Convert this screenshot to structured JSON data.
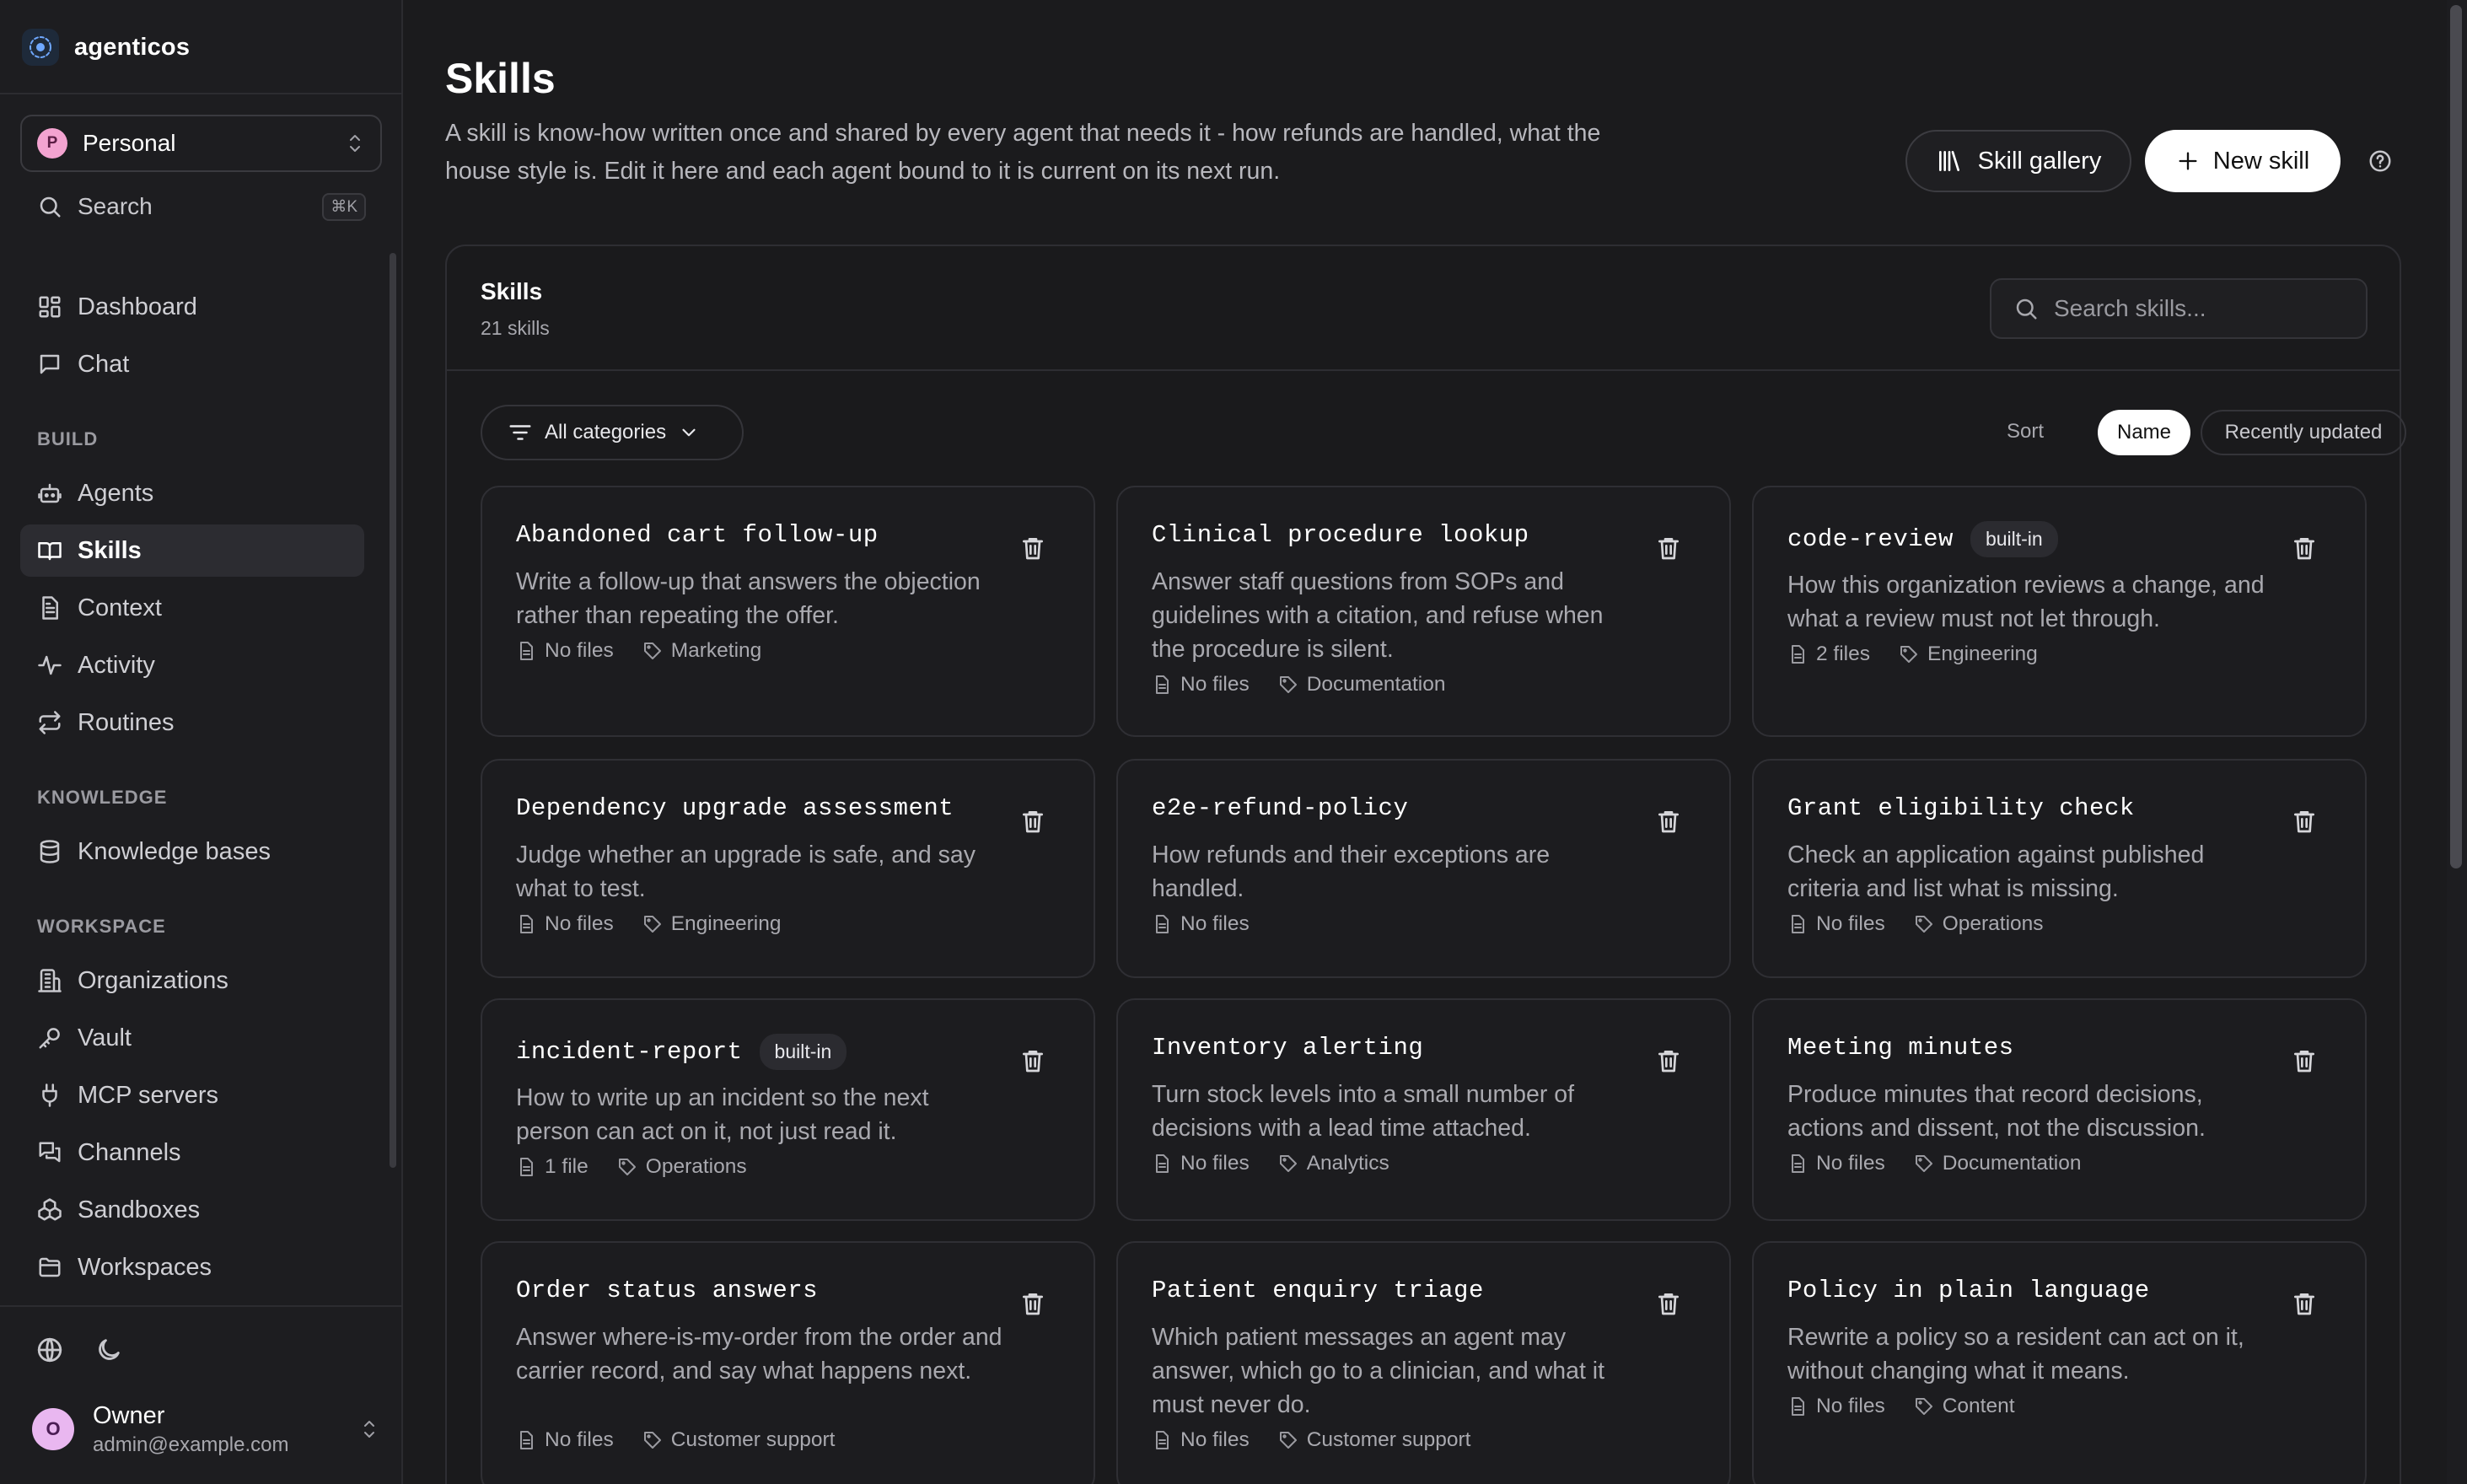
{
  "app": {
    "name": "agenticos"
  },
  "workspace": {
    "avatar": "P",
    "name": "Personal"
  },
  "search": {
    "label": "Search",
    "shortcut": "⌘K"
  },
  "nav": {
    "top": [
      {
        "id": "dashboard",
        "label": "Dashboard",
        "icon": "dashboard-icon"
      },
      {
        "id": "chat",
        "label": "Chat",
        "icon": "chat-icon"
      }
    ],
    "build_label": "BUILD",
    "build": [
      {
        "id": "agents",
        "label": "Agents",
        "icon": "bot-icon"
      },
      {
        "id": "skills",
        "label": "Skills",
        "icon": "book-icon",
        "active": true
      },
      {
        "id": "context",
        "label": "Context",
        "icon": "document-icon"
      },
      {
        "id": "activity",
        "label": "Activity",
        "icon": "activity-icon"
      },
      {
        "id": "routines",
        "label": "Routines",
        "icon": "repeat-icon"
      }
    ],
    "knowledge_label": "KNOWLEDGE",
    "knowledge": [
      {
        "id": "knowledge-bases",
        "label": "Knowledge bases",
        "icon": "database-icon"
      }
    ],
    "workspace_label": "WORKSPACE",
    "workspace": [
      {
        "id": "organizations",
        "label": "Organizations",
        "icon": "building-icon"
      },
      {
        "id": "vault",
        "label": "Vault",
        "icon": "key-icon"
      },
      {
        "id": "mcp-servers",
        "label": "MCP servers",
        "icon": "plug-icon"
      },
      {
        "id": "channels",
        "label": "Channels",
        "icon": "messages-icon"
      },
      {
        "id": "sandboxes",
        "label": "Sandboxes",
        "icon": "boxes-icon"
      },
      {
        "id": "workspaces",
        "label": "Workspaces",
        "icon": "folder-icon"
      }
    ]
  },
  "user": {
    "avatar": "O",
    "name": "Owner",
    "email": "admin@example.com"
  },
  "page": {
    "title": "Skills",
    "description": "A skill is know-how written once and shared by every agent that needs it - how refunds are handled, what the house style is. Edit it here and each agent bound to it is current on its next run.",
    "gallery_button": "Skill gallery",
    "new_button": "New skill"
  },
  "panel": {
    "title": "Skills",
    "count": "21 skills",
    "search_placeholder": "Search skills...",
    "category_filter": "All categories",
    "sort_label": "Sort",
    "sort_options": [
      {
        "label": "Name",
        "active": true
      },
      {
        "label": "Recently updated",
        "active": false
      }
    ]
  },
  "skills": [
    {
      "name": "Abandoned cart follow-up",
      "badge": "",
      "description": "Write a follow-up that answers the objection rather than repeating the offer.",
      "files": "No files",
      "category": "Marketing"
    },
    {
      "name": "Clinical procedure lookup",
      "badge": "",
      "description": "Answer staff questions from SOPs and guidelines with a citation, and refuse when the procedure is silent.",
      "files": "No files",
      "category": "Documentation"
    },
    {
      "name": "code-review",
      "badge": "built-in",
      "description": "How this organization reviews a change, and what a review must not let through.",
      "files": "2 files",
      "category": "Engineering"
    },
    {
      "name": "Dependency upgrade assessment",
      "badge": "",
      "description": "Judge whether an upgrade is safe, and say what to test.",
      "files": "No files",
      "category": "Engineering"
    },
    {
      "name": "e2e-refund-policy",
      "badge": "",
      "description": "How refunds and their exceptions are handled.",
      "files": "No files",
      "category": ""
    },
    {
      "name": "Grant eligibility check",
      "badge": "",
      "description": "Check an application against published criteria and list what is missing.",
      "files": "No files",
      "category": "Operations"
    },
    {
      "name": "incident-report",
      "badge": "built-in",
      "description": "How to write up an incident so the next person can act on it, not just read it.",
      "files": "1 file",
      "category": "Operations"
    },
    {
      "name": "Inventory alerting",
      "badge": "",
      "description": "Turn stock levels into a small number of decisions with a lead time attached.",
      "files": "No files",
      "category": "Analytics"
    },
    {
      "name": "Meeting minutes",
      "badge": "",
      "description": "Produce minutes that record decisions, actions and dissent, not the discussion.",
      "files": "No files",
      "category": "Documentation"
    },
    {
      "name": "Order status answers",
      "badge": "",
      "description": "Answer where-is-my-order from the order and carrier record, and say what happens next.",
      "files": "No files",
      "category": "Customer support"
    },
    {
      "name": "Patient enquiry triage",
      "badge": "",
      "description": "Which patient messages an agent may answer, which go to a clinician, and what it must never do.",
      "files": "No files",
      "category": "Customer support"
    },
    {
      "name": "Policy in plain language",
      "badge": "",
      "description": "Rewrite a policy so a resident can act on it, without changing what it means.",
      "files": "No files",
      "category": "Content"
    }
  ]
}
